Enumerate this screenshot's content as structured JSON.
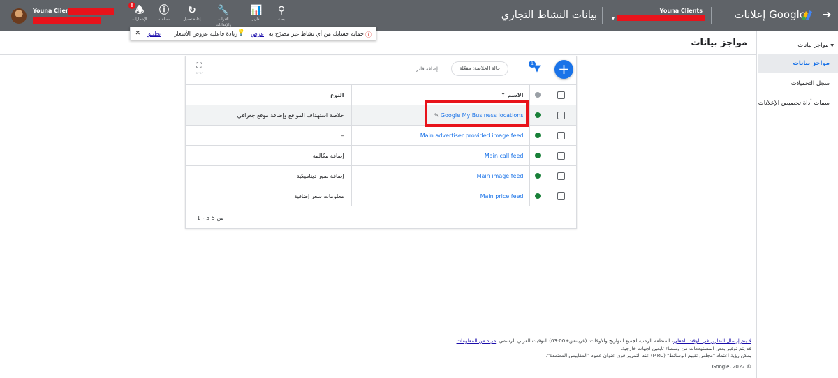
{
  "header": {
    "product_name": "إعلانات Google",
    "client_name": "Youna Clients",
    "page_title": "بيانات النشاط التجاري",
    "account_name": "Youna Clients",
    "tools": [
      {
        "icon": "search-icon",
        "label": "بحث"
      },
      {
        "icon": "reports-icon",
        "label": "تقارير"
      },
      {
        "icon": "wrench-icon",
        "label": "الأدوات والإعدادات"
      },
      {
        "icon": "refresh-icon",
        "label": "إعادة تحميل"
      },
      {
        "icon": "help-icon",
        "label": "مساعدة"
      },
      {
        "icon": "bell-icon",
        "label": "الإشعارات"
      }
    ]
  },
  "notice": {
    "text1": "حماية حسابك من أي نشاط غير مصرّح به",
    "link1": "عرض",
    "text2": "زيادة فاعلية عروض الأسعار",
    "link2": "تطبيق"
  },
  "sidenav": {
    "parent": "مواجز بيانات",
    "items": [
      {
        "label": "مواجز بيانات"
      },
      {
        "label": "سجل التحميلات"
      },
      {
        "label": "سمات أداة تخصيص الإعلانات"
      }
    ]
  },
  "main": {
    "title": "مواجز بيانات",
    "filter_badge": "1",
    "chip_label": "حالة الخلاصة: مفعّلة",
    "add_filter": "إضافة فلتر",
    "expand_label": "توسيع",
    "columns": {
      "name": "الاسم",
      "type": "النوع"
    },
    "rows": [
      {
        "name": "Google My Business locations",
        "type": "خلاصة استهداف المواقع وإضافة موقع جغرافي"
      },
      {
        "name": "Main advertiser provided image feed",
        "type": "–"
      },
      {
        "name": "Main call feed",
        "type": "إضافة مكالمة"
      },
      {
        "name": "Main image feed",
        "type": "إضافة صور ديناميكية"
      },
      {
        "name": "Main price feed",
        "type": "معلومات سعر إضافية"
      }
    ],
    "pagination": "1 - 5 من 5"
  },
  "footer": {
    "line1_link": "لا يتم إرسال التقارير في الوقت الفعلي",
    "line1_text": "المنطقة الزمنية لجميع التواريخ والأوقات: (غرينتش+03:00) التوقيت العربي الرسمي.",
    "line1_more": "مزيد من المعلومات",
    "line2": "قد يتم توفير بعض المستودمات من وسطاء تابعين لجهات خارجية.",
    "line3": "يمكن رؤية اعتماد \"مجلس تقييم الوسائط\" (MRC) عند التمرير فوق عنوان عمود \"المقاييس المعتمدة\".",
    "copyright": "© Google، 2022"
  },
  "colors": {
    "topbar": "#5f6368",
    "accent": "#1a73e8",
    "status_enabled": "#188038",
    "highlight": "#e8131b"
  }
}
